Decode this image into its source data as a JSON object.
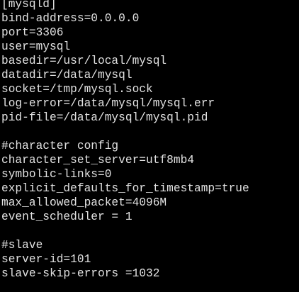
{
  "theme": {
    "background": "#000000",
    "text_color": "#e2e2e2"
  },
  "config_lines": [
    "[mysqld]",
    "bind-address=0.0.0.0",
    "port=3306",
    "user=mysql",
    "basedir=/usr/local/mysql",
    "datadir=/data/mysql",
    "socket=/tmp/mysql.sock",
    "log-error=/data/mysql/mysql.err",
    "pid-file=/data/mysql/mysql.pid",
    "",
    "#character config",
    "character_set_server=utf8mb4",
    "symbolic-links=0",
    "explicit_defaults_for_timestamp=true",
    "max_allowed_packet=4096M",
    "event_scheduler = 1",
    "",
    "#slave",
    "server-id=101",
    "slave-skip-errors =1032"
  ]
}
